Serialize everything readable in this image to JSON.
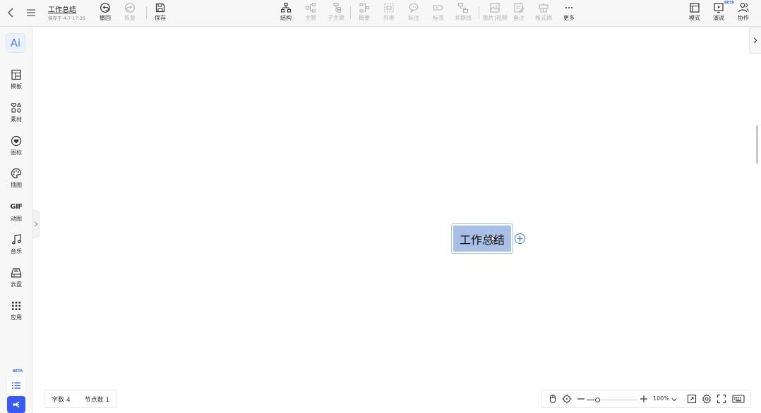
{
  "header": {
    "title": "工作总结",
    "saved_text": "保存于 4-7 17:35",
    "tools": [
      {
        "id": "undo",
        "label": "撤回",
        "icon": "undo-icon",
        "enabled": true
      },
      {
        "id": "redo",
        "label": "恢复",
        "icon": "redo-icon",
        "enabled": false
      },
      {
        "id": "save",
        "label": "保存",
        "icon": "save-icon",
        "enabled": true
      },
      {
        "id": "structure",
        "label": "结构",
        "icon": "structure-icon",
        "enabled": true
      },
      {
        "id": "topic",
        "label": "主题",
        "icon": "topic-icon",
        "enabled": false
      },
      {
        "id": "subtopic",
        "label": "子主题",
        "icon": "subtopic-icon",
        "enabled": false
      },
      {
        "id": "summary",
        "label": "概要",
        "icon": "summary-icon",
        "enabled": false
      },
      {
        "id": "frame",
        "label": "外框",
        "icon": "frame-icon",
        "enabled": false
      },
      {
        "id": "callout",
        "label": "标注",
        "icon": "callout-icon",
        "enabled": false
      },
      {
        "id": "tag",
        "label": "标签",
        "icon": "tag-icon",
        "enabled": false
      },
      {
        "id": "relation",
        "label": "关联线",
        "icon": "relation-icon",
        "enabled": false
      },
      {
        "id": "media",
        "label": "图片|视频",
        "icon": "image-video-icon",
        "enabled": false
      },
      {
        "id": "note",
        "label": "备注",
        "icon": "note-icon",
        "enabled": false
      },
      {
        "id": "format",
        "label": "格式刷",
        "icon": "format-brush-icon",
        "enabled": false
      },
      {
        "id": "more",
        "label": "更多",
        "icon": "more-icon",
        "enabled": true
      }
    ],
    "right_tools": [
      {
        "id": "mode",
        "label": "模式",
        "icon": "mode-icon"
      },
      {
        "id": "present",
        "label": "演说",
        "icon": "present-icon",
        "badge": "BETA"
      },
      {
        "id": "collab",
        "label": "协作",
        "icon": "collab-icon"
      }
    ]
  },
  "sidebar": {
    "ai_label": "Ai",
    "items": [
      {
        "id": "template",
        "label": "模板",
        "icon": "template-icon"
      },
      {
        "id": "material",
        "label": "素材",
        "icon": "material-icon"
      },
      {
        "id": "icon",
        "label": "图标",
        "icon": "heart-icon"
      },
      {
        "id": "illustration",
        "label": "插图",
        "icon": "palette-icon"
      },
      {
        "id": "gif",
        "label": "动图",
        "icon": "gif-icon",
        "glyph": "GIF"
      },
      {
        "id": "music",
        "label": "音乐",
        "icon": "music-icon"
      },
      {
        "id": "cloud",
        "label": "云盘",
        "icon": "cloud-drive-icon"
      },
      {
        "id": "apps",
        "label": "应用",
        "icon": "apps-icon"
      }
    ],
    "beta_badge": "BETA"
  },
  "canvas": {
    "root_node": "工作总结"
  },
  "status": {
    "word_count": "字数 4",
    "node_count": "节点数 1"
  },
  "zoom": {
    "level": "100%",
    "fraction": 0.22
  },
  "colors": {
    "accent": "#3b5bf0",
    "node_fill": "#a9bfe5",
    "node_border": "#9cc3f3"
  }
}
